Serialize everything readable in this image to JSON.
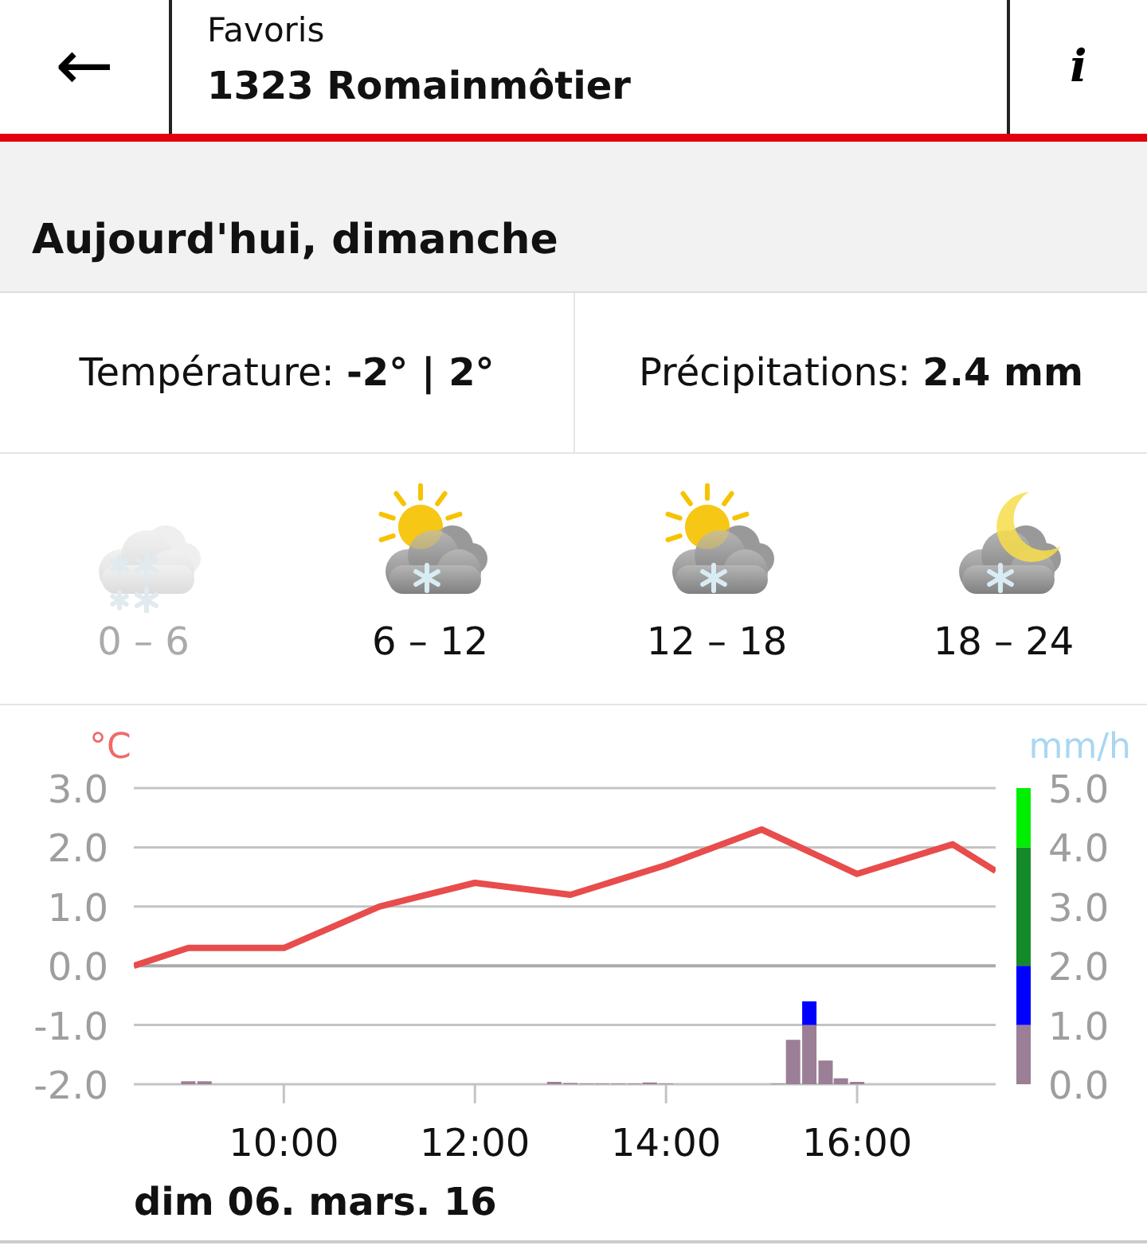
{
  "header": {
    "back_icon": "←",
    "subtitle": "Favoris",
    "title": "1323 Romainmôtier",
    "info_icon": "i"
  },
  "day": {
    "title": "Aujourd'hui, dimanche"
  },
  "stats": [
    {
      "text": "Température: **-2° | 2°**"
    },
    {
      "text": "Précipitations: **2.4 mm**"
    }
  ],
  "periods": [
    {
      "kind": "snow",
      "label": "0 – 6",
      "past": true
    },
    {
      "kind": "sun-snow",
      "label": "6 – 12",
      "past": false
    },
    {
      "kind": "sun-snow",
      "label": "12 – 18",
      "past": false
    },
    {
      "kind": "moon-snow",
      "label": "18 – 24",
      "past": false
    }
  ],
  "temperature_chart": {
    "chart_data": {
      "type": "line",
      "ylabel": "°C",
      "xlim": [
        8.43,
        17.45
      ],
      "ylim": [
        -2,
        3
      ],
      "grid": true,
      "yticks": [
        {
          "value": 3,
          "label": "3.0"
        },
        {
          "value": 2,
          "label": "2.0"
        },
        {
          "value": 1,
          "label": "1.0"
        },
        {
          "value": 0,
          "label": "0.0"
        },
        {
          "value": -1,
          "label": "-1.0"
        },
        {
          "value": -2,
          "label": "-2.0"
        }
      ],
      "xticks": [
        {
          "value": 10,
          "label": "10:00"
        },
        {
          "value": 12,
          "label": "12:00"
        },
        {
          "value": 14,
          "label": "14:00"
        },
        {
          "value": 16,
          "label": "16:00"
        }
      ],
      "x": [
        8.43,
        9,
        10,
        11,
        12,
        13,
        14,
        15,
        16,
        17,
        17.45
      ],
      "series": [
        {
          "color": "#e84c4c",
          "values": [
            0.0,
            0.3,
            0.3,
            1.0,
            1.4,
            1.2,
            1.7,
            2.3,
            1.55,
            2.05,
            1.6
          ]
        }
      ]
    }
  },
  "precipitation_chart": {
    "chart_data": {
      "type": "bar",
      "ylabel": "mm/h",
      "xlim": [
        8.43,
        17.45
      ],
      "ylim": [
        0,
        5
      ],
      "stacked": true,
      "yticks": [
        {
          "value": 5,
          "label": "5.0"
        },
        {
          "value": 4,
          "label": "4.0"
        },
        {
          "value": 3,
          "label": "3.0"
        },
        {
          "value": 2,
          "label": "2.0"
        },
        {
          "value": 1,
          "label": "1.0"
        },
        {
          "value": 0,
          "label": "0.0"
        }
      ],
      "x": [
        9.0,
        9.17,
        12.83,
        13.0,
        13.17,
        13.33,
        13.5,
        13.67,
        13.83,
        14.0,
        15.17,
        15.33,
        15.5,
        15.67,
        15.83,
        16.0
      ],
      "series": [
        {
          "color": "#9b7f96",
          "values": [
            0.05,
            0.05,
            0.04,
            0.02,
            0.01,
            0.01,
            0.01,
            0.01,
            0.03,
            0.01,
            0.01,
            0.75,
            1.0,
            0.4,
            0.1,
            0.04
          ]
        },
        {
          "color": "#0000ff",
          "values": [
            null,
            null,
            null,
            null,
            null,
            null,
            null,
            null,
            null,
            null,
            null,
            null,
            0.4,
            null,
            null,
            null
          ]
        }
      ]
    }
  },
  "date": "dim 06. mars. 16"
}
